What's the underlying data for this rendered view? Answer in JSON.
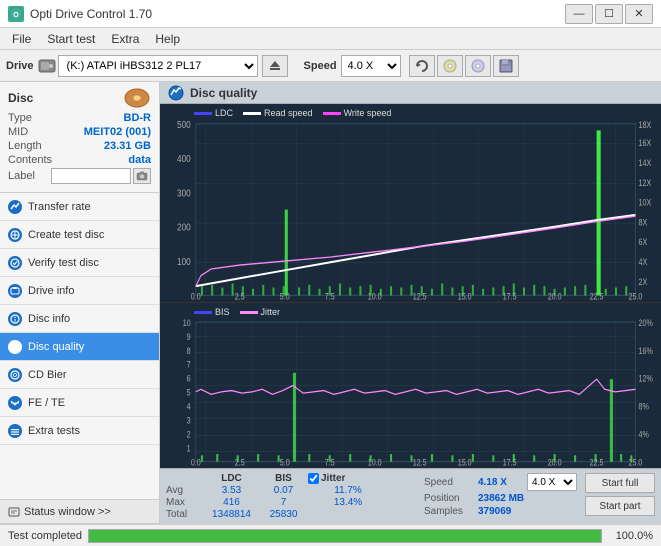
{
  "window": {
    "title": "Opti Drive Control 1.70",
    "icon": "ODC"
  },
  "titlebar": {
    "minimize": "—",
    "maximize": "☐",
    "close": "✕"
  },
  "menu": {
    "items": [
      "File",
      "Start test",
      "Extra",
      "Help"
    ]
  },
  "drive_toolbar": {
    "drive_label": "Drive",
    "drive_value": "(K:)  ATAPI iHBS312  2 PL17",
    "speed_label": "Speed",
    "speed_value": "4.0 X"
  },
  "disc": {
    "label": "Disc",
    "type_label": "Type",
    "type_value": "BD-R",
    "mid_label": "MID",
    "mid_value": "MEIT02 (001)",
    "length_label": "Length",
    "length_value": "23.31 GB",
    "contents_label": "Contents",
    "contents_value": "data",
    "label_label": "Label",
    "label_value": ""
  },
  "nav": {
    "items": [
      {
        "id": "transfer-rate",
        "label": "Transfer rate",
        "active": false
      },
      {
        "id": "create-test-disc",
        "label": "Create test disc",
        "active": false
      },
      {
        "id": "verify-test-disc",
        "label": "Verify test disc",
        "active": false
      },
      {
        "id": "drive-info",
        "label": "Drive info",
        "active": false
      },
      {
        "id": "disc-info",
        "label": "Disc info",
        "active": false
      },
      {
        "id": "disc-quality",
        "label": "Disc quality",
        "active": true
      },
      {
        "id": "cd-bier",
        "label": "CD Bier",
        "active": false
      },
      {
        "id": "fe-te",
        "label": "FE / TE",
        "active": false
      },
      {
        "id": "extra-tests",
        "label": "Extra tests",
        "active": false
      }
    ],
    "status_window": "Status window >>"
  },
  "disc_quality": {
    "title": "Disc quality",
    "legend": {
      "ldc": "LDC",
      "read_speed": "Read speed",
      "write_speed": "Write speed",
      "bis": "BIS",
      "jitter": "Jitter"
    }
  },
  "stats": {
    "headers": [
      "",
      "LDC",
      "BIS",
      "",
      "Jitter",
      "Speed",
      ""
    ],
    "avg_label": "Avg",
    "avg_ldc": "3.53",
    "avg_bis": "0.07",
    "avg_jitter": "11.7%",
    "max_label": "Max",
    "max_ldc": "416",
    "max_bis": "7",
    "max_jitter": "13.4%",
    "total_label": "Total",
    "total_ldc": "1348814",
    "total_bis": "25830",
    "speed_label": "Speed",
    "speed_value": "4.18 X",
    "speed_select": "4.0 X",
    "position_label": "Position",
    "position_value": "23862 MB",
    "samples_label": "Samples",
    "samples_value": "379069",
    "start_full": "Start full",
    "start_part": "Start part",
    "jitter_checked": true,
    "jitter_label": "Jitter"
  },
  "status_bar": {
    "text": "Test completed",
    "progress": 100.0,
    "progress_text": "100.0%"
  },
  "chart1": {
    "x_labels": [
      "0.0",
      "2.5",
      "5.0",
      "7.5",
      "10.0",
      "12.5",
      "15.0",
      "17.5",
      "20.0",
      "22.5",
      "25.0"
    ],
    "y_left": [
      "500",
      "400",
      "300",
      "200",
      "100"
    ],
    "y_right": [
      "18X",
      "16X",
      "14X",
      "12X",
      "10X",
      "8X",
      "6X",
      "4X",
      "2X"
    ]
  },
  "chart2": {
    "x_labels": [
      "0.0",
      "2.5",
      "5.0",
      "7.5",
      "10.0",
      "12.5",
      "15.0",
      "17.5",
      "20.0",
      "22.5",
      "25.0"
    ],
    "y_left": [
      "10",
      "9",
      "8",
      "7",
      "6",
      "5",
      "4",
      "3",
      "2",
      "1"
    ],
    "y_right": [
      "20%",
      "16%",
      "12%",
      "8%",
      "4%"
    ]
  }
}
